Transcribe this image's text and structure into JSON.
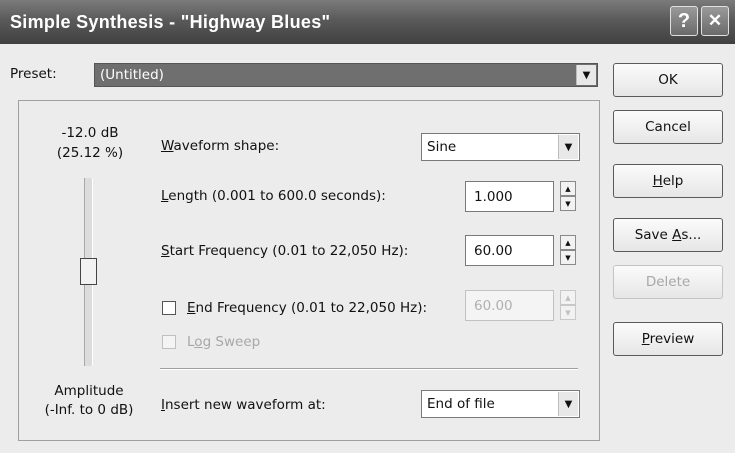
{
  "window": {
    "title": "Simple Synthesis - \"Highway Blues\"",
    "help_glyph": "?",
    "close_glyph": "✕"
  },
  "preset": {
    "label": "Preset:",
    "value": "(Untitled)"
  },
  "amplitude": {
    "db_value": "-12.0 dB",
    "percent_value": "(25.12 %)",
    "label": "Amplitude",
    "range": "(-Inf. to 0 dB)",
    "level_fraction": 0.2512
  },
  "waveform_shape": {
    "label_pre": "",
    "label_ul": "W",
    "label_post": "aveform shape:",
    "value": "Sine"
  },
  "length": {
    "label_pre": "",
    "label_ul": "L",
    "label_post": "ength (0.001 to 600.0 seconds):",
    "value": "1.000"
  },
  "start_frequency": {
    "label_pre": "",
    "label_ul": "S",
    "label_post": "tart Frequency (0.01 to 22,050 Hz):",
    "value": "60.00"
  },
  "end_frequency": {
    "label_pre": "",
    "label_ul": "E",
    "label_post": "nd Frequency (0.01 to 22,050 Hz):",
    "value": "60.00",
    "checked": false
  },
  "log_sweep": {
    "label_pre": "L",
    "label_ul": "o",
    "label_post": "g Sweep",
    "checked": false
  },
  "insert_at": {
    "label_pre": "",
    "label_ul": "I",
    "label_post": "nsert new waveform at:",
    "value": "End of file"
  },
  "buttons": {
    "ok": "OK",
    "cancel": "Cancel",
    "help_ul": "H",
    "help_post": "elp",
    "save_as_pre": "Save ",
    "save_as_ul": "A",
    "save_as_post": "s...",
    "delete": "Delete",
    "preview_ul": "P",
    "preview_post": "review"
  },
  "icons": {
    "dropdown": "▼",
    "spin_up": "▲",
    "spin_down": "▼"
  },
  "colors": {
    "titlebar": "#5a5a5a",
    "dialog_bg": "#ececec",
    "preset_highlight": "#6f6f6f"
  }
}
